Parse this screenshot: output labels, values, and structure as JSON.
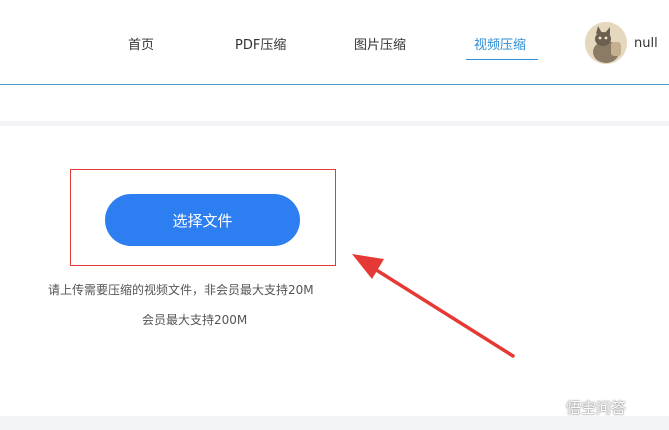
{
  "nav": {
    "items": [
      {
        "label": "首页"
      },
      {
        "label": "PDF压缩"
      },
      {
        "label": "图片压缩"
      },
      {
        "label": "视频压缩",
        "active": true
      }
    ],
    "active_color": "#2e8fd6"
  },
  "user": {
    "name": "null"
  },
  "upload": {
    "button_label": "选择文件",
    "hint_line1": "请上传需要压缩的视频文件，非会员最大支持20M",
    "hint_line2": "会员最大支持200M",
    "button_color": "#2d7ff1"
  },
  "annotation": {
    "box_color": "#e03a3a",
    "arrow_color": "#e53935"
  },
  "watermark": {
    "text": "悟空问答",
    "icon": "wukong-logo-icon"
  }
}
